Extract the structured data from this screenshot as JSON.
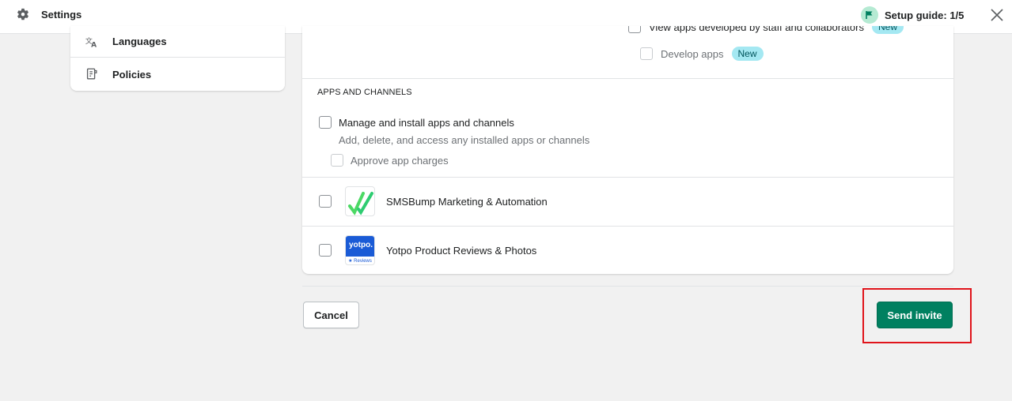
{
  "topbar": {
    "title": "Settings",
    "setup_guide": "Setup guide: 1/5"
  },
  "nav": {
    "items": [
      {
        "label": "Languages",
        "icon": "translate-icon"
      },
      {
        "label": "Policies",
        "icon": "policy-document-icon"
      }
    ]
  },
  "permissions": {
    "partial_row_label": "View apps developed by staff and collaborators",
    "partial_row_badge": "New",
    "develop_apps_label": "Develop apps",
    "develop_apps_badge": "New",
    "apps_section_heading": "APPS AND CHANNELS",
    "manage_label": "Manage and install apps and channels",
    "manage_description": "Add, delete, and access any installed apps or channels",
    "approve_label": "Approve app charges",
    "apps": [
      {
        "name": "SMSBump Marketing & Automation",
        "logo": "smsbump-logo"
      },
      {
        "name": "Yotpo Product Reviews & Photos",
        "logo": "yotpo-logo",
        "logo_text": "yotpo.",
        "logo_subtext": "★ Reviews"
      }
    ]
  },
  "actions": {
    "cancel_label": "Cancel",
    "send_label": "Send invite"
  },
  "colors": {
    "primary": "#008060",
    "badge_bg": "#a4e8f2",
    "highlight": "#e0141b",
    "flag_bg": "#b5ead3"
  }
}
